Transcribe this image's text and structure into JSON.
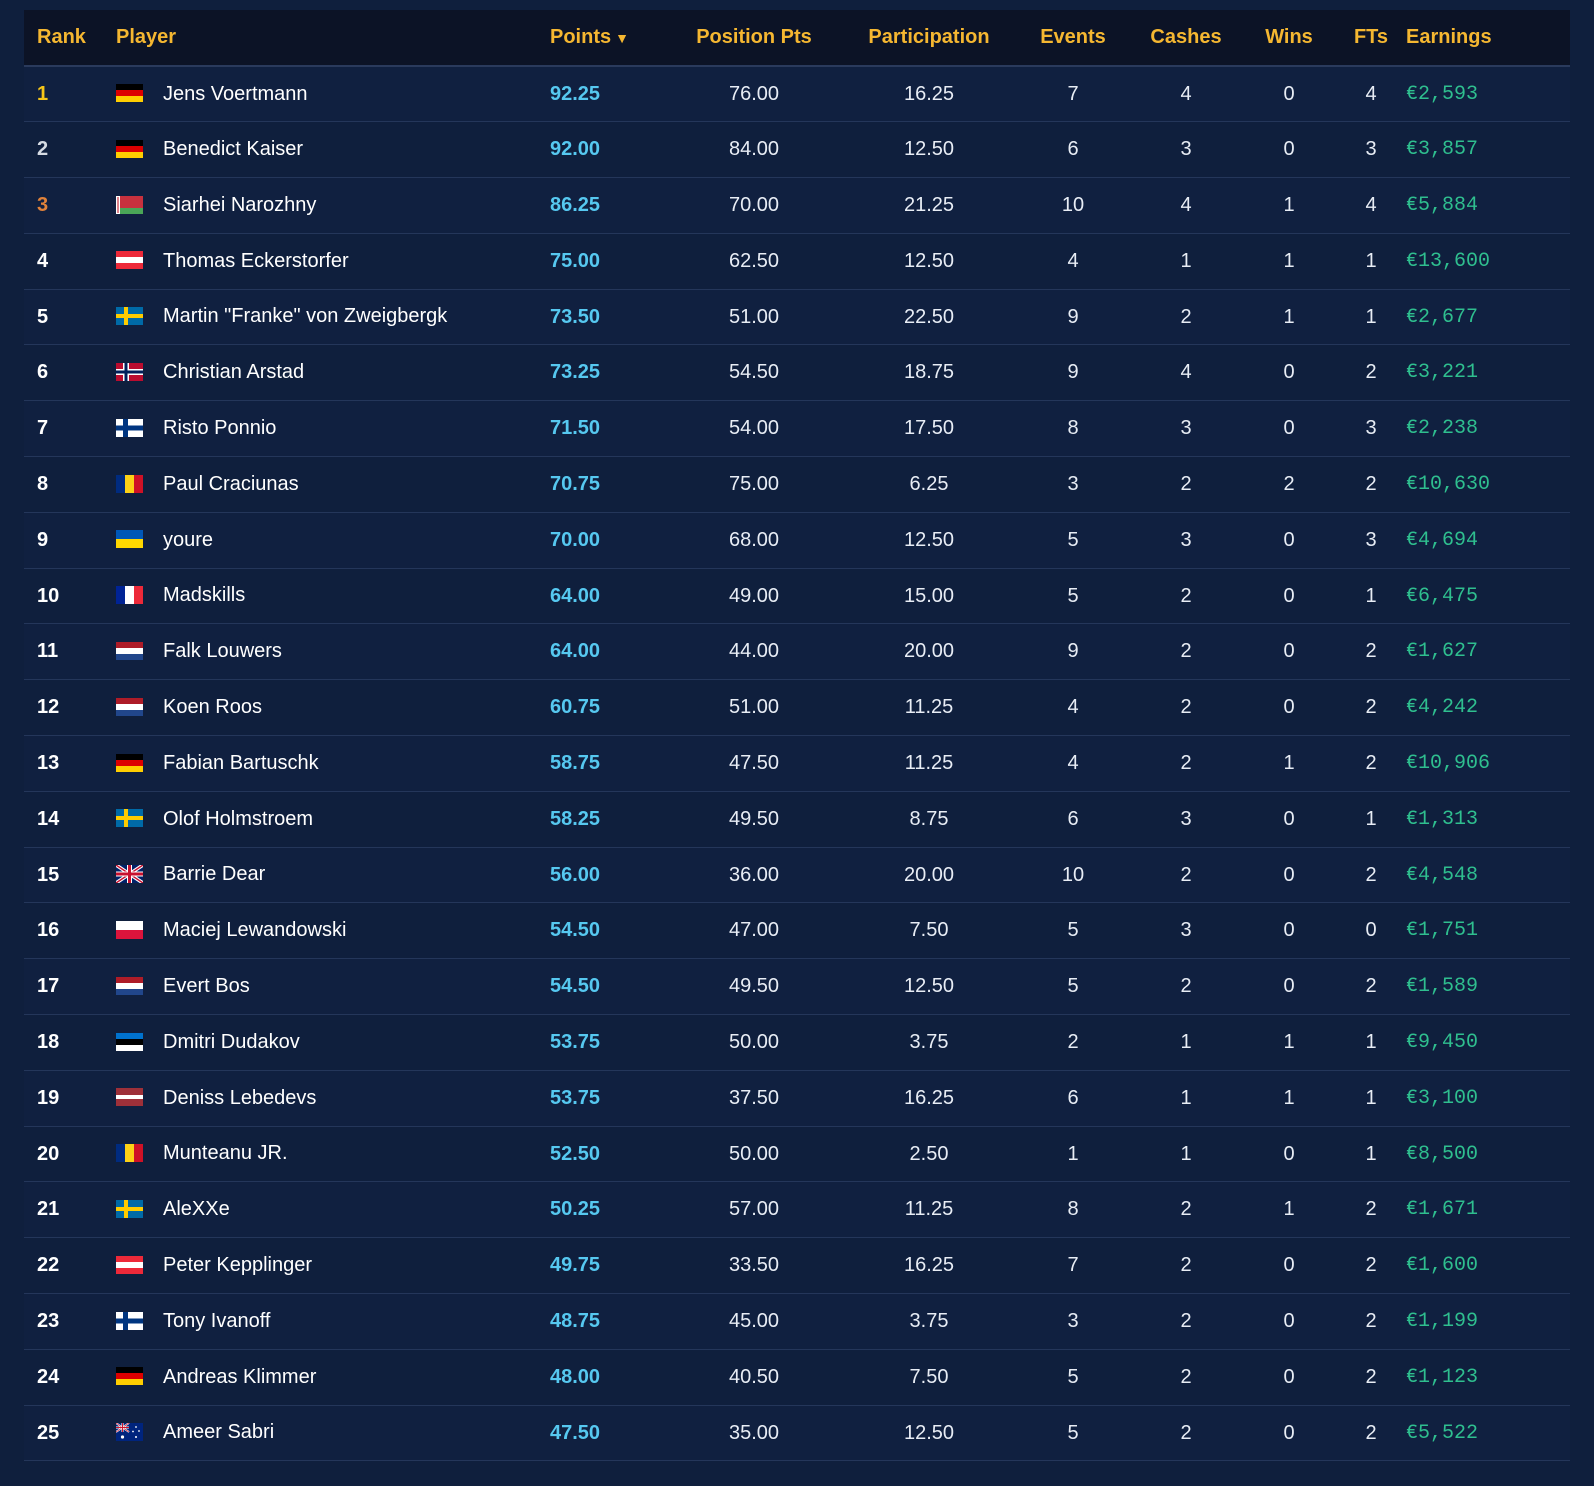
{
  "table": {
    "headers": {
      "rank": "Rank",
      "player": "Player",
      "points": "Points",
      "position_pts": "Position Pts",
      "participation": "Participation",
      "events": "Events",
      "cashes": "Cashes",
      "wins": "Wins",
      "fts": "FTs",
      "earnings": "Earnings"
    },
    "sort": {
      "column": "points",
      "direction": "descending",
      "indicator": "▼"
    },
    "colors": {
      "header_text": "#f5b731",
      "points": "#56c8f0",
      "earnings": "#2fbf8f",
      "rank_1": "#f5c518",
      "rank_2": "#d6dbe3",
      "rank_3": "#e0823a"
    },
    "rows": [
      {
        "rank": "1",
        "flag": "germany-flag",
        "player": "Jens Voertmann",
        "points": "92.25",
        "position_pts": "76.00",
        "participation": "16.25",
        "events": "7",
        "cashes": "4",
        "wins": "0",
        "fts": "4",
        "earnings": "€2,593"
      },
      {
        "rank": "2",
        "flag": "germany-flag",
        "player": "Benedict Kaiser",
        "points": "92.00",
        "position_pts": "84.00",
        "participation": "12.50",
        "events": "6",
        "cashes": "3",
        "wins": "0",
        "fts": "3",
        "earnings": "€3,857"
      },
      {
        "rank": "3",
        "flag": "belarus-flag",
        "player": "Siarhei Narozhny",
        "points": "86.25",
        "position_pts": "70.00",
        "participation": "21.25",
        "events": "10",
        "cashes": "4",
        "wins": "1",
        "fts": "4",
        "earnings": "€5,884"
      },
      {
        "rank": "4",
        "flag": "austria-flag",
        "player": "Thomas Eckerstorfer",
        "points": "75.00",
        "position_pts": "62.50",
        "participation": "12.50",
        "events": "4",
        "cashes": "1",
        "wins": "1",
        "fts": "1",
        "earnings": "€13,600"
      },
      {
        "rank": "5",
        "flag": "sweden-flag",
        "player": "Martin \"Franke\" von Zweigbergk",
        "points": "73.50",
        "position_pts": "51.00",
        "participation": "22.50",
        "events": "9",
        "cashes": "2",
        "wins": "1",
        "fts": "1",
        "earnings": "€2,677"
      },
      {
        "rank": "6",
        "flag": "norway-flag",
        "player": "Christian Arstad",
        "points": "73.25",
        "position_pts": "54.50",
        "participation": "18.75",
        "events": "9",
        "cashes": "4",
        "wins": "0",
        "fts": "2",
        "earnings": "€3,221"
      },
      {
        "rank": "7",
        "flag": "finland-flag",
        "player": "Risto Ponnio",
        "points": "71.50",
        "position_pts": "54.00",
        "participation": "17.50",
        "events": "8",
        "cashes": "3",
        "wins": "0",
        "fts": "3",
        "earnings": "€2,238"
      },
      {
        "rank": "8",
        "flag": "romania-flag",
        "player": "Paul Craciunas",
        "points": "70.75",
        "position_pts": "75.00",
        "participation": "6.25",
        "events": "3",
        "cashes": "2",
        "wins": "2",
        "fts": "2",
        "earnings": "€10,630"
      },
      {
        "rank": "9",
        "flag": "ukraine-flag",
        "player": "youre",
        "points": "70.00",
        "position_pts": "68.00",
        "participation": "12.50",
        "events": "5",
        "cashes": "3",
        "wins": "0",
        "fts": "3",
        "earnings": "€4,694"
      },
      {
        "rank": "10",
        "flag": "france-flag",
        "player": "Madskills",
        "points": "64.00",
        "position_pts": "49.00",
        "participation": "15.00",
        "events": "5",
        "cashes": "2",
        "wins": "0",
        "fts": "1",
        "earnings": "€6,475"
      },
      {
        "rank": "11",
        "flag": "netherlands-flag",
        "player": "Falk Louwers",
        "points": "64.00",
        "position_pts": "44.00",
        "participation": "20.00",
        "events": "9",
        "cashes": "2",
        "wins": "0",
        "fts": "2",
        "earnings": "€1,627"
      },
      {
        "rank": "12",
        "flag": "netherlands-flag",
        "player": "Koen Roos",
        "points": "60.75",
        "position_pts": "51.00",
        "participation": "11.25",
        "events": "4",
        "cashes": "2",
        "wins": "0",
        "fts": "2",
        "earnings": "€4,242"
      },
      {
        "rank": "13",
        "flag": "germany-flag",
        "player": "Fabian Bartuschk",
        "points": "58.75",
        "position_pts": "47.50",
        "participation": "11.25",
        "events": "4",
        "cashes": "2",
        "wins": "1",
        "fts": "2",
        "earnings": "€10,906"
      },
      {
        "rank": "14",
        "flag": "sweden-flag",
        "player": "Olof Holmstroem",
        "points": "58.25",
        "position_pts": "49.50",
        "participation": "8.75",
        "events": "6",
        "cashes": "3",
        "wins": "0",
        "fts": "1",
        "earnings": "€1,313"
      },
      {
        "rank": "15",
        "flag": "uk-flag",
        "player": "Barrie Dear",
        "points": "56.00",
        "position_pts": "36.00",
        "participation": "20.00",
        "events": "10",
        "cashes": "2",
        "wins": "0",
        "fts": "2",
        "earnings": "€4,548"
      },
      {
        "rank": "16",
        "flag": "poland-flag",
        "player": "Maciej Lewandowski",
        "points": "54.50",
        "position_pts": "47.00",
        "participation": "7.50",
        "events": "5",
        "cashes": "3",
        "wins": "0",
        "fts": "0",
        "earnings": "€1,751"
      },
      {
        "rank": "17",
        "flag": "netherlands-flag",
        "player": "Evert Bos",
        "points": "54.50",
        "position_pts": "49.50",
        "participation": "12.50",
        "events": "5",
        "cashes": "2",
        "wins": "0",
        "fts": "2",
        "earnings": "€1,589"
      },
      {
        "rank": "18",
        "flag": "estonia-flag",
        "player": "Dmitri Dudakov",
        "points": "53.75",
        "position_pts": "50.00",
        "participation": "3.75",
        "events": "2",
        "cashes": "1",
        "wins": "1",
        "fts": "1",
        "earnings": "€9,450"
      },
      {
        "rank": "19",
        "flag": "latvia-flag",
        "player": "Deniss Lebedevs",
        "points": "53.75",
        "position_pts": "37.50",
        "participation": "16.25",
        "events": "6",
        "cashes": "1",
        "wins": "1",
        "fts": "1",
        "earnings": "€3,100"
      },
      {
        "rank": "20",
        "flag": "romania-flag",
        "player": "Munteanu JR.",
        "points": "52.50",
        "position_pts": "50.00",
        "participation": "2.50",
        "events": "1",
        "cashes": "1",
        "wins": "0",
        "fts": "1",
        "earnings": "€8,500"
      },
      {
        "rank": "21",
        "flag": "sweden-flag",
        "player": "AleXXe",
        "points": "50.25",
        "position_pts": "57.00",
        "participation": "11.25",
        "events": "8",
        "cashes": "2",
        "wins": "1",
        "fts": "2",
        "earnings": "€1,671"
      },
      {
        "rank": "22",
        "flag": "austria-flag",
        "player": "Peter Kepplinger",
        "points": "49.75",
        "position_pts": "33.50",
        "participation": "16.25",
        "events": "7",
        "cashes": "2",
        "wins": "0",
        "fts": "2",
        "earnings": "€1,600"
      },
      {
        "rank": "23",
        "flag": "finland-flag",
        "player": "Tony Ivanoff",
        "points": "48.75",
        "position_pts": "45.00",
        "participation": "3.75",
        "events": "3",
        "cashes": "2",
        "wins": "0",
        "fts": "2",
        "earnings": "€1,199"
      },
      {
        "rank": "24",
        "flag": "germany-flag",
        "player": "Andreas Klimmer",
        "points": "48.00",
        "position_pts": "40.50",
        "participation": "7.50",
        "events": "5",
        "cashes": "2",
        "wins": "0",
        "fts": "2",
        "earnings": "€1,123"
      },
      {
        "rank": "25",
        "flag": "australia-flag",
        "player": "Ameer Sabri",
        "points": "47.50",
        "position_pts": "35.00",
        "participation": "12.50",
        "events": "5",
        "cashes": "2",
        "wins": "0",
        "fts": "2",
        "earnings": "€5,522"
      }
    ]
  }
}
